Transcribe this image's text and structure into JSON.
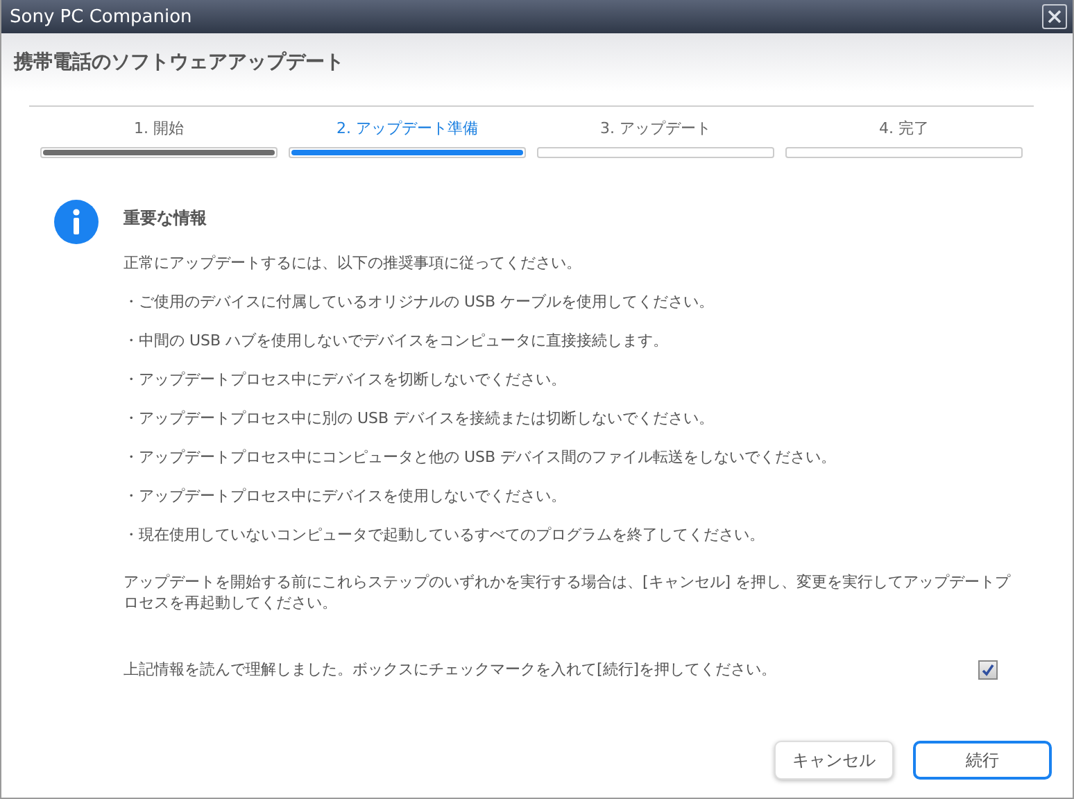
{
  "window": {
    "title": "Sony PC Companion"
  },
  "header": {
    "title": "携帯電話のソフトウェアアップデート"
  },
  "steps": [
    {
      "label": "1. 開始",
      "completed": true,
      "selected": false
    },
    {
      "label": "2. アップデート準備",
      "completed": true,
      "selected": true
    },
    {
      "label": "3. アップデート",
      "completed": false,
      "selected": false
    },
    {
      "label": "4. 完了",
      "completed": false,
      "selected": false
    }
  ],
  "info": {
    "heading": "重要な情報",
    "intro": "正常にアップデートするには、以下の推奨事項に従ってください。",
    "items": [
      "・ご使用のデバイスに付属しているオリジナルの USB ケーブルを使用してください。",
      "・中間の USB ハブを使用しないでデバイスをコンピュータに直接接続します。",
      "・アップデートプロセス中にデバイスを切断しないでください。",
      "・アップデートプロセス中に別の USB デバイスを接続または切断しないでください。",
      "・アップデートプロセス中にコンピュータと他の USB デバイス間のファイル転送をしないでください。",
      "・アップデートプロセス中にデバイスを使用しないでください。",
      "・現在使用していないコンピュータで起動しているすべてのプログラムを終了してください。"
    ],
    "note": "アップデートを開始する前にこれらステップのいずれかを実行する場合は、[キャンセル] を押し、変更を実行してアップデートプロセスを再起動してください。"
  },
  "confirm": {
    "label": "上記情報を読んで理解しました。ボックスにチェックマークを入れて[続行]を押してください。",
    "checked": true
  },
  "buttons": [
    {
      "label": "キャンセル",
      "kind": "secondary"
    },
    {
      "label": "続行",
      "kind": "primary"
    }
  ]
}
